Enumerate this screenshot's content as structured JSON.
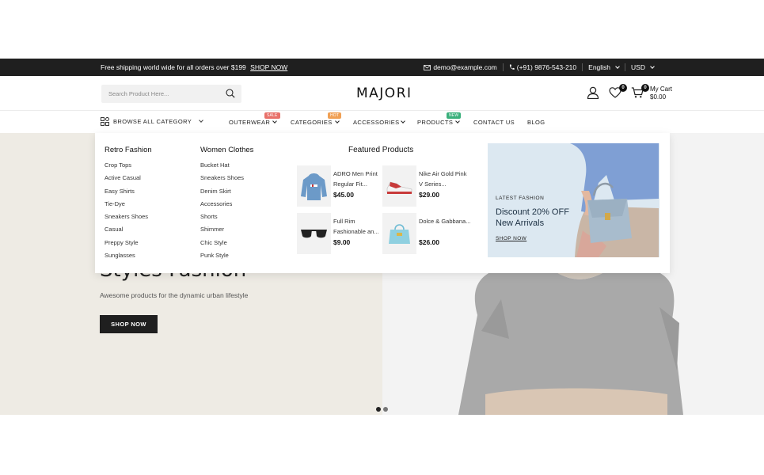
{
  "topbar": {
    "shipping_text": "Free shipping world wide for all orders over $199",
    "shipping_link": "SHOP NOW",
    "email": "demo@example.com",
    "phone": "(+91) 9876-543-210",
    "language": "English",
    "currency": "USD"
  },
  "header": {
    "search_placeholder": "Search Product Here...",
    "logo": "MAJORI",
    "wishlist_count": "0",
    "cart_count": "0",
    "cart_label": "My Cart",
    "cart_total": "$0.00"
  },
  "nav": {
    "browse_label": "BROWSE ALL CATEGORY",
    "items": [
      {
        "label": "OUTERWEAR",
        "badge": "SALE"
      },
      {
        "label": "CATEGORIES",
        "badge": "HOT"
      },
      {
        "label": "ACCESSORIES",
        "badge": ""
      },
      {
        "label": "PRODUCTS",
        "badge": "NEW"
      },
      {
        "label": "CONTACT US",
        "badge": ""
      },
      {
        "label": "BLOG",
        "badge": ""
      }
    ]
  },
  "mega": {
    "col1": {
      "title": "Retro Fashion",
      "items": [
        "Crop Tops",
        "Active Casual",
        "Easy Shirts",
        "Tie-Dye",
        "Sneakers Shoes",
        "Casual",
        "Preppy Style",
        "Sunglasses"
      ]
    },
    "col2": {
      "title": "Women Clothes",
      "items": [
        "Bucket Hat",
        "Sneakers Shoes",
        "Denim Skirt",
        "Accessories",
        "Shorts",
        "Shimmer",
        "Chic Style",
        "Punk Style"
      ]
    },
    "featured_title": "Featured Products",
    "products": [
      {
        "name": "ADRO Men Print Regular Fit...",
        "price": "$45.00",
        "icon": "hoodie-icon"
      },
      {
        "name": "Nike Air Gold Pink V Series...",
        "price": "$29.00",
        "icon": "sneaker-icon"
      },
      {
        "name": "Full Rim Fashionable an...",
        "price": "$9.00",
        "icon": "sunglasses-icon"
      },
      {
        "name": "Dolce & Gabbana...",
        "price": "$26.00",
        "icon": "handbag-icon"
      }
    ],
    "promo": {
      "tag": "LATEST FASHION",
      "headline": "Discount 20% OFF New Arrivals",
      "link": "SHOP NOW"
    }
  },
  "hero": {
    "title": "Stylės Fashion",
    "subtitle": "Awesome products for the dynamic urban lifestyle",
    "button": "SHOP NOW"
  },
  "colors": {
    "topbar_bg": "#1f1f1f",
    "hero_bg": "#eeebe4",
    "sale_badge": "#e8716a",
    "hot_badge": "#f0a055",
    "new_badge": "#3bb07c"
  }
}
